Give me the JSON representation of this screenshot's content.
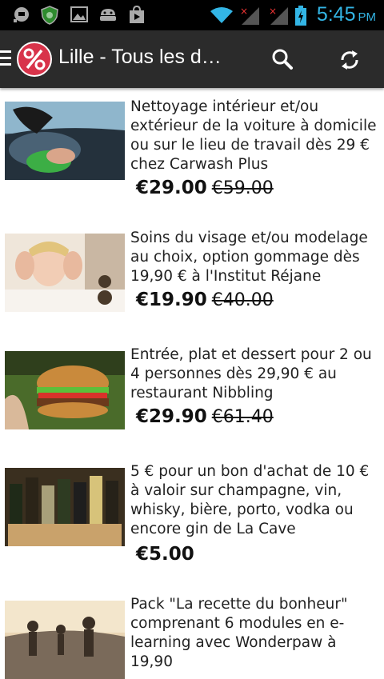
{
  "status_bar": {
    "time": "5:45",
    "ampm": "PM",
    "icons": [
      "notification-icon",
      "shield-icon",
      "image-icon",
      "android-icon",
      "play-store-icon",
      "wifi-icon",
      "signal-icon",
      "signal-icon",
      "battery-charging-icon"
    ]
  },
  "app_bar": {
    "title": "Lille - Tous les d…",
    "icons": [
      "menu-icon",
      "percent-logo-icon",
      "search-icon",
      "refresh-icon"
    ],
    "accent": "#d8334a"
  },
  "deals": [
    {
      "title": "Nettoyage intérieur et/ou extérieur de la voiture à domicile ou sur le lieu de travail dès 29 € chez Carwash Plus",
      "price": "€29.00",
      "old_price": "€59.00"
    },
    {
      "title": "Soins du visage et/ou modelage au choix, option gommage dès 19,90 € à l'Institut Réjane",
      "price": "€19.90",
      "old_price": "€40.00"
    },
    {
      "title": "Entrée, plat et dessert pour 2 ou 4 personnes dès 29,90 € au restaurant Nibbling",
      "price": "€29.90",
      "old_price": "€61.40"
    },
    {
      "title": "5 € pour un bon d'achat de 10 € à valoir sur champagne, vin, whisky, bière, porto, vodka ou encore gin de La Cave",
      "price": "€5.00",
      "old_price": ""
    },
    {
      "title": "Pack \"La recette du bonheur\" comprenant 6 modules en e-learning avec Wonderpaw à 19,90",
      "price": "",
      "old_price": ""
    }
  ]
}
